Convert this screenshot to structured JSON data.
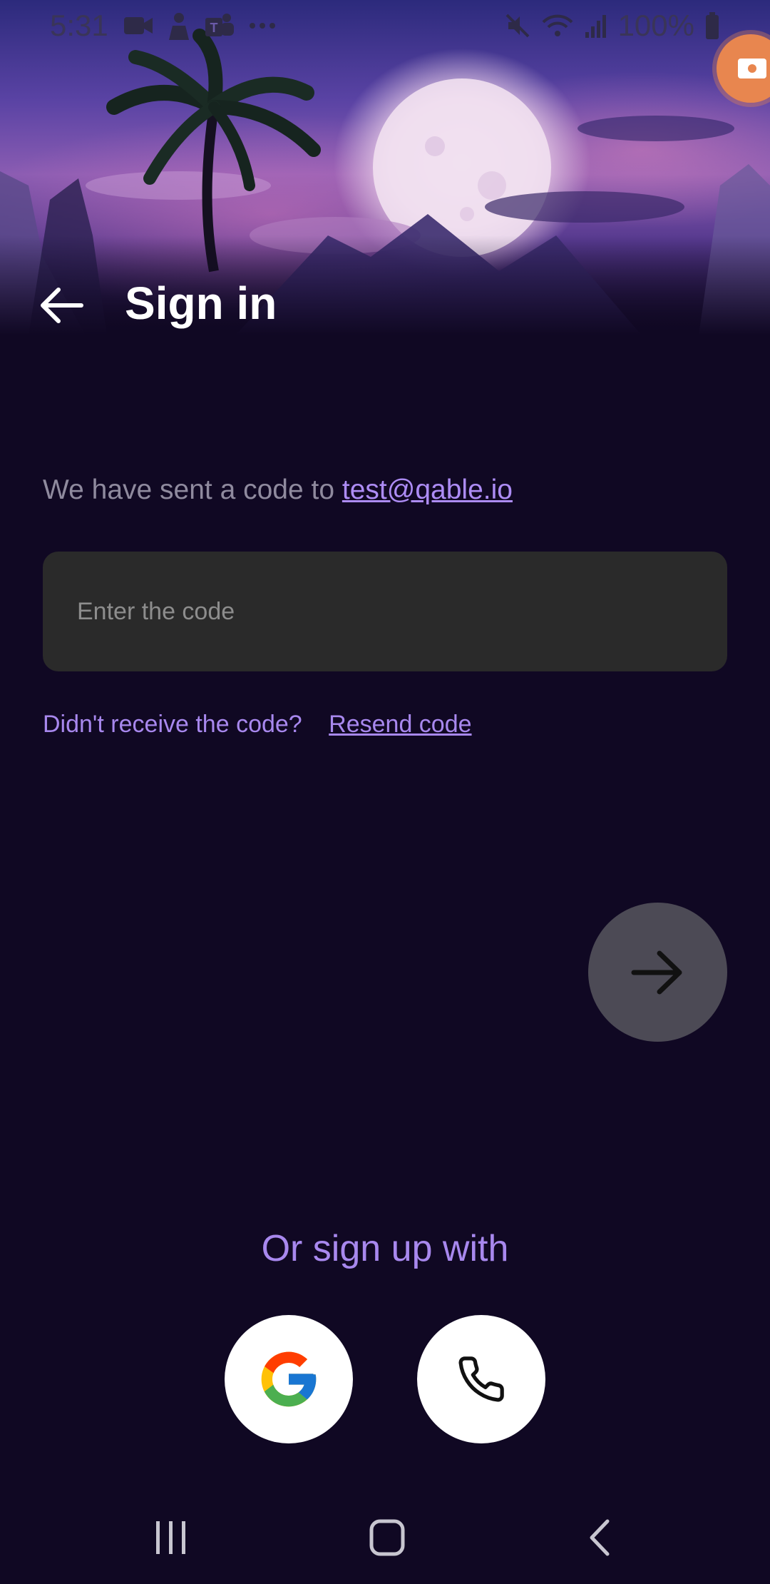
{
  "status_bar": {
    "time": "5:31",
    "battery": "100%",
    "left_icons": [
      "video-icon",
      "person-icon",
      "teams-icon",
      "more-icon"
    ],
    "right_icons": [
      "mute-icon",
      "wifi-icon",
      "signal-icon",
      "battery-icon"
    ]
  },
  "header": {
    "title": "Sign in",
    "back_icon": "arrow-left-icon"
  },
  "verification": {
    "message": "We have sent a code to",
    "email": "test@qable.io"
  },
  "code_field": {
    "placeholder": "Enter the code",
    "value": ""
  },
  "resend": {
    "question": "Didn't receive the code?",
    "link": "Resend code"
  },
  "next_button": {
    "icon": "arrow-right-icon"
  },
  "social": {
    "label": "Or sign up with",
    "buttons": [
      {
        "name": "google",
        "icon": "google-icon"
      },
      {
        "name": "phone",
        "icon": "phone-icon"
      }
    ]
  },
  "colors": {
    "background": "#100823",
    "accent": "#a888ee",
    "link": "#ad8cf5",
    "input_bg": "#2a2a2a",
    "next_button_bg": "#4c4a55"
  },
  "nav_bar": {
    "buttons": [
      "recents-icon",
      "home-icon",
      "back-icon"
    ]
  }
}
